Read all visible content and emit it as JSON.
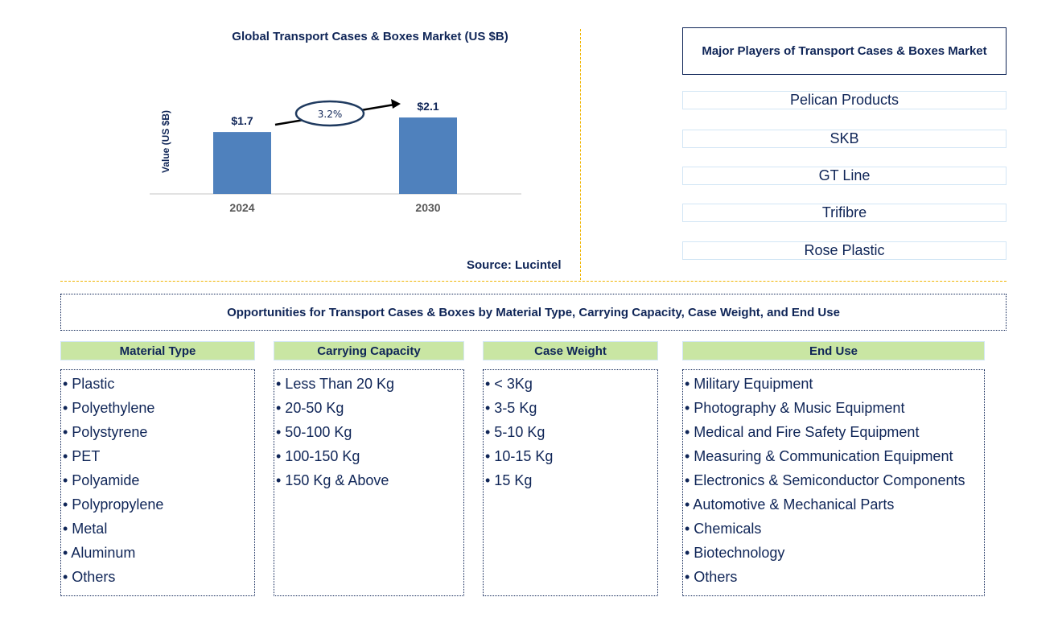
{
  "chart_data": {
    "type": "bar",
    "title": "Global Transport Cases & Boxes Market (US $B)",
    "xlabel": "",
    "ylabel": "Value (US $B)",
    "categories": [
      "2024",
      "2030"
    ],
    "values": [
      1.7,
      2.1
    ],
    "data_labels": [
      "$1.7",
      "$2.1"
    ],
    "ylim": [
      0,
      2.2
    ],
    "grid": false,
    "bar_color": "#4f81bd",
    "annotation": {
      "text": "3.2%",
      "meaning": "CAGR 2024-2030"
    }
  },
  "source": "Source: Lucintel",
  "players": {
    "title": "Major Players of Transport Cases & Boxes Market",
    "items": [
      "Pelican Products",
      "SKB",
      "GT Line",
      "Trifibre",
      "Rose Plastic"
    ]
  },
  "opportunities": {
    "title": "Opportunities for Transport Cases & Boxes by Material Type, Carrying Capacity, Case Weight, and End Use",
    "columns": [
      {
        "header": "Material Type",
        "items": [
          "• Plastic",
          "• Polyethylene",
          "• Polystyrene",
          "• PET",
          "• Polyamide",
          "• Polypropylene",
          "• Metal",
          "• Aluminum",
          "• Others"
        ]
      },
      {
        "header": "Carrying Capacity",
        "items": [
          "• Less Than 20 Kg",
          "• 20-50 Kg",
          "• 50-100 Kg",
          "• 100-150 Kg",
          "• 150 Kg & Above"
        ]
      },
      {
        "header": "Case Weight",
        "items": [
          "• < 3Kg",
          "• 3-5 Kg",
          "• 5-10 Kg",
          "• 10-15 Kg",
          "• 15 Kg"
        ]
      },
      {
        "header": "End Use",
        "items": [
          "• Military Equipment",
          "• Photography & Music Equipment",
          "• Medical and Fire Safety Equipment",
          "• Measuring & Communication Equipment",
          "• Electronics & Semiconductor Components",
          "• Automotive & Mechanical Parts",
          "• Chemicals",
          "• Biotechnology",
          "• Others"
        ]
      }
    ]
  },
  "colors": {
    "text": "#0f2557",
    "bar": "#4f81bd",
    "header_bg": "#c9e6a3",
    "divider": "#f0b400"
  }
}
